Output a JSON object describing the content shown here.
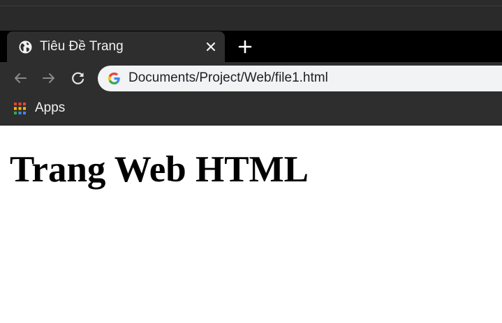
{
  "tab": {
    "title": "Tiêu Đề Trang",
    "favicon": "globe-icon",
    "close": "close-icon"
  },
  "new_tab": "plus-icon",
  "toolbar": {
    "back": "arrow-left-icon",
    "forward": "arrow-right-icon",
    "reload": "reload-icon",
    "address": "Documents/Project/Web/file1.html",
    "search_engine_icon": "google-g-icon"
  },
  "bookmarks": {
    "apps_icon": "apps-grid-icon",
    "apps_label": "Apps"
  },
  "page": {
    "heading": "Trang Web HTML"
  },
  "colors": {
    "tabstrip": "#000000",
    "tab_active": "#2e2e2e",
    "toolbar": "#2e2e2e",
    "omnibox": "#f1f3f4",
    "page_background": "#ffffff",
    "heading_text": "#000000"
  }
}
